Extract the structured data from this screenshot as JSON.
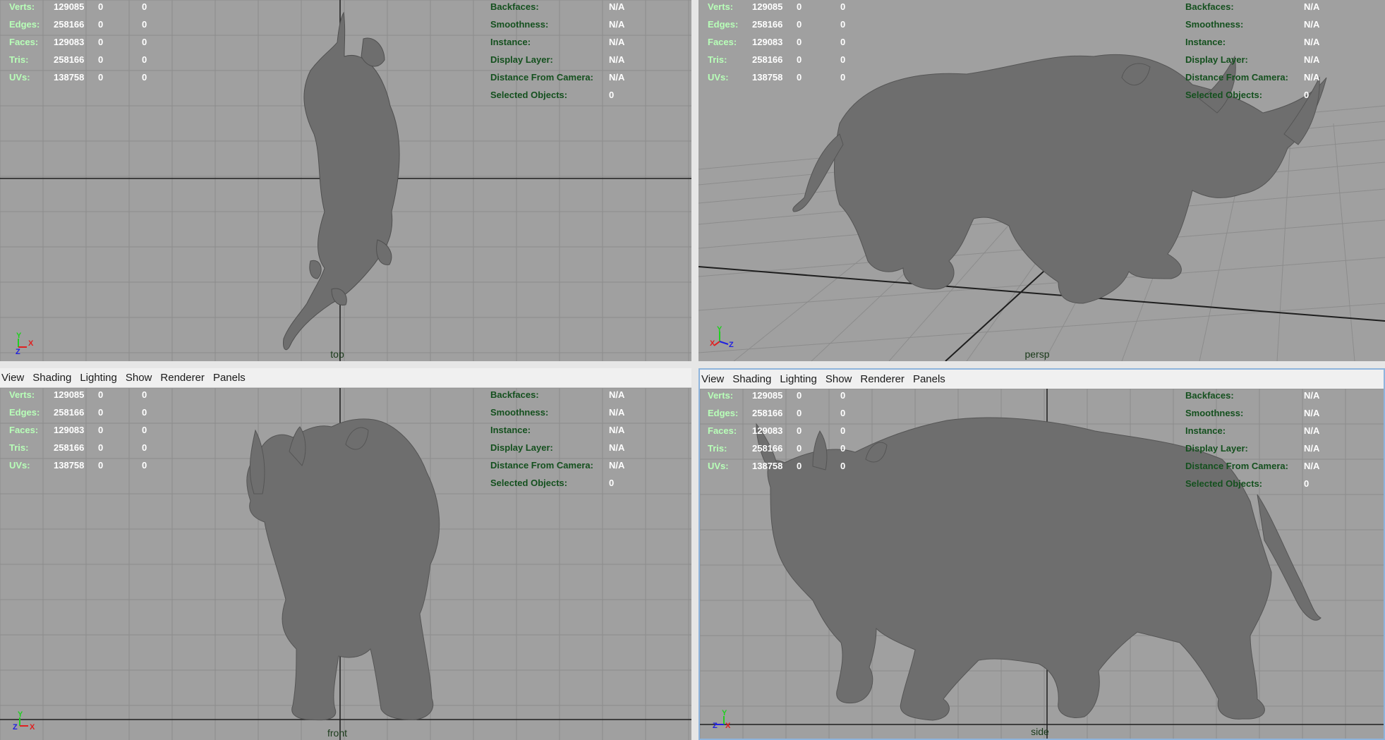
{
  "menu": [
    "View",
    "Shading",
    "Lighting",
    "Show",
    "Renderer",
    "Panels"
  ],
  "hud": {
    "left": [
      {
        "label": "Verts:",
        "v1": "129085",
        "v2": "0",
        "v3": "0"
      },
      {
        "label": "Edges:",
        "v1": "258166",
        "v2": "0",
        "v3": "0"
      },
      {
        "label": "Faces:",
        "v1": "129083",
        "v2": "0",
        "v3": "0"
      },
      {
        "label": "Tris:",
        "v1": "258166",
        "v2": "0",
        "v3": "0"
      },
      {
        "label": "UVs:",
        "v1": "138758",
        "v2": "0",
        "v3": "0"
      }
    ],
    "right": [
      {
        "label": "Backfaces:",
        "value": "N/A"
      },
      {
        "label": "Smoothness:",
        "value": "N/A"
      },
      {
        "label": "Instance:",
        "value": "N/A"
      },
      {
        "label": "Display Layer:",
        "value": "N/A"
      },
      {
        "label": "Distance From Camera:",
        "value": "N/A"
      },
      {
        "label": "Selected Objects:",
        "value": "0"
      }
    ]
  },
  "views": {
    "top": {
      "camera": "top",
      "axes": [
        "Y",
        "X",
        "Z"
      ]
    },
    "persp": {
      "camera": "persp",
      "axes": [
        "Y",
        "X",
        "Z"
      ]
    },
    "front": {
      "camera": "front",
      "axes": [
        "Y",
        "Z",
        "X"
      ]
    },
    "side": {
      "camera": "side",
      "axes": [
        "Y",
        "Z",
        "X"
      ]
    }
  },
  "colors": {
    "viewport_bg": "#a0a0a0",
    "grid": "#8c8c8c",
    "axis_line": "#1e1e1e",
    "model": "#6e6e6e",
    "hud_label_left": "#b8ffb8",
    "hud_label_right": "#14501e",
    "axis_x": "#e02020",
    "axis_y": "#20d020",
    "axis_z": "#2020e0",
    "active_border": "#8eb4dc"
  }
}
